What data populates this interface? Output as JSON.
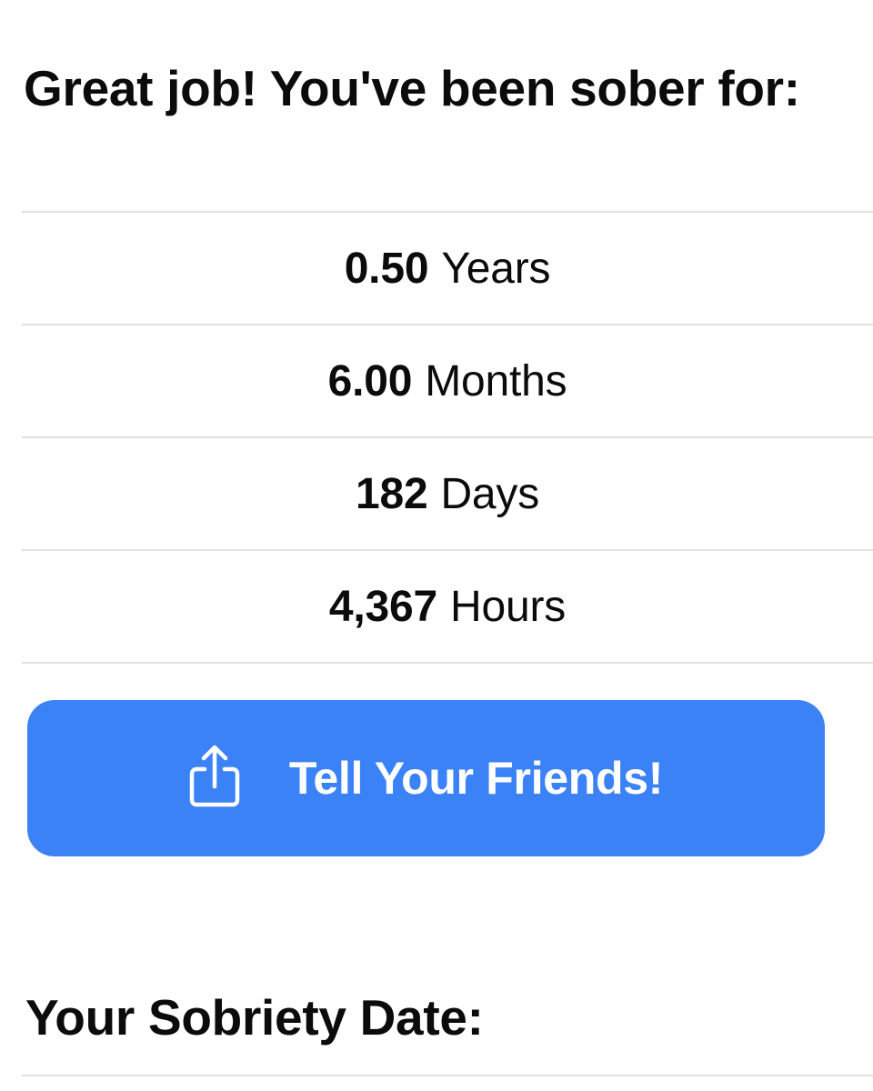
{
  "header": {
    "title": "Great job! You've been sober for:"
  },
  "stats": [
    {
      "value": "0.50",
      "unit": "Years"
    },
    {
      "value": "6.00",
      "unit": "Months"
    },
    {
      "value": "182",
      "unit": "Days"
    },
    {
      "value": "4,367",
      "unit": "Hours"
    }
  ],
  "share_button": {
    "label": "Tell Your Friends!",
    "icon": "share-icon",
    "color": "#3b82f7"
  },
  "sobriety_date": {
    "heading": "Your Sobriety Date:"
  }
}
